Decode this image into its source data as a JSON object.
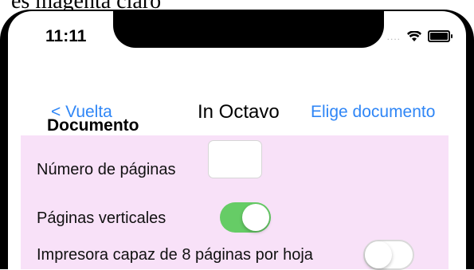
{
  "caption": "es magenta claro",
  "status_bar": {
    "time": "11:11",
    "signal_dots": "....",
    "wifi_icon": "wifi-icon",
    "battery_icon": "battery-icon"
  },
  "nav": {
    "back_label": "< Vuelta",
    "title": "In Octavo",
    "right_label": "Elige documento"
  },
  "section": {
    "header": "Documento",
    "background": "#f8e1f8",
    "rows": [
      {
        "label": "Número de páginas",
        "input_value": ""
      },
      {
        "label": "Páginas verticales",
        "toggle_on": true
      },
      {
        "label": "Impresora capaz de 8 páginas por hoja",
        "toggle_on": false
      }
    ]
  },
  "colors": {
    "accent": "#2f86f6",
    "toggle_on": "#66cc66"
  }
}
